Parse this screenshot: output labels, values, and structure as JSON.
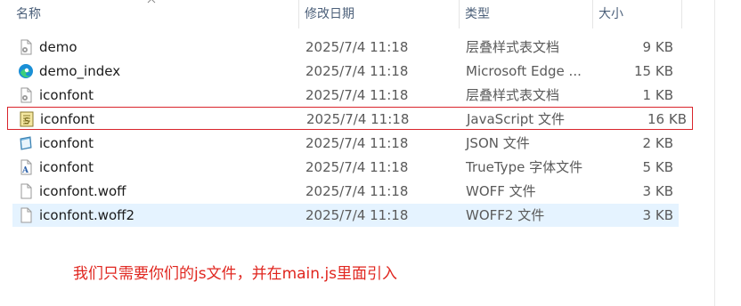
{
  "header": {
    "name_label": "名称",
    "date_label": "修改日期",
    "type_label": "类型",
    "size_label": "大小"
  },
  "files": [
    {
      "name": "demo",
      "date": "2025/7/4 11:18",
      "type": "层叠样式表文档",
      "size": "9 KB",
      "icon": "css-file-icon"
    },
    {
      "name": "demo_index",
      "date": "2025/7/4 11:18",
      "type": "Microsoft Edge ...",
      "size": "15 KB",
      "icon": "edge-html-icon"
    },
    {
      "name": "iconfont",
      "date": "2025/7/4 11:18",
      "type": "层叠样式表文档",
      "size": "1 KB",
      "icon": "css-file-icon"
    },
    {
      "name": "iconfont",
      "date": "2025/7/4 11:18",
      "type": "JavaScript 文件",
      "size": "16 KB",
      "icon": "js-file-icon"
    },
    {
      "name": "iconfont",
      "date": "2025/7/4 11:18",
      "type": "JSON 文件",
      "size": "2 KB",
      "icon": "json-file-icon"
    },
    {
      "name": "iconfont",
      "date": "2025/7/4 11:18",
      "type": "TrueType 字体文件",
      "size": "5 KB",
      "icon": "ttf-file-icon"
    },
    {
      "name": "iconfont.woff",
      "date": "2025/7/4 11:18",
      "type": "WOFF 文件",
      "size": "3 KB",
      "icon": "blank-file-icon"
    },
    {
      "name": "iconfont.woff2",
      "date": "2025/7/4 11:18",
      "type": "WOFF2 文件",
      "size": "3 KB",
      "icon": "blank-file-icon"
    }
  ],
  "annotation": "我们只需要你们的js文件，并在main.js里面引入",
  "colors": {
    "highlight_border": "#d9242b",
    "selected_row": "#e5f3ff",
    "annotation_text": "#e0261f"
  }
}
